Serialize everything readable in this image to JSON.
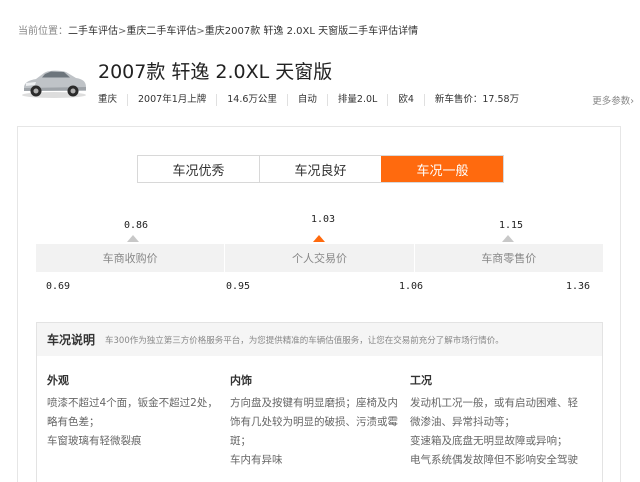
{
  "breadcrumb": {
    "prefix": "当前位置：",
    "items": [
      "二手车评估",
      "重庆二手车评估",
      "重庆2007款 轩逸 2.0XL 天窗版二手车评估详情"
    ],
    "separator": ">"
  },
  "car": {
    "title": "2007款 轩逸 2.0XL 天窗版",
    "specs": [
      "重庆",
      "2007年1月上牌",
      "14.6万公里",
      "自动",
      "排量2.0L",
      "欧4",
      "新车售价：17.58万"
    ],
    "more_params": "更多参数›"
  },
  "tabs": [
    {
      "label": "车况优秀",
      "active": false
    },
    {
      "label": "车况良好",
      "active": false
    },
    {
      "label": "车况一般",
      "active": true
    }
  ],
  "prices": {
    "top": [
      "0.86",
      "1.03",
      "1.15"
    ],
    "labels": [
      "车商收购价",
      "个人交易价",
      "车商零售价"
    ],
    "bottom": [
      "0.69",
      "0.95",
      "1.06",
      "1.36"
    ]
  },
  "condition": {
    "title": "车况说明",
    "desc": "车300作为独立第三方价格服务平台，为您提供精准的车辆估值服务，让您在交易前充分了解市场行情价。",
    "columns": [
      {
        "heading": "外观",
        "lines": [
          "喷漆不超过4个面，钣金不超过2处，",
          "略有色差；",
          "车窗玻璃有轻微裂痕"
        ]
      },
      {
        "heading": "内饰",
        "lines": [
          "方向盘及按键有明显磨损；座椅及内",
          "饰有几处较为明显的破损、污渍或霉",
          "斑；",
          "车内有异味"
        ]
      },
      {
        "heading": "工况",
        "lines": [
          "发动机工况一般，或有启动困难、轻",
          "微渗油、异常抖动等；",
          "变速箱及底盘无明显故障或异响；",
          "电气系统偶发故障但不影响安全驾驶"
        ]
      }
    ]
  },
  "colors": {
    "accent": "#ff6a0e",
    "marker_inactive": "#c8c8c8"
  }
}
